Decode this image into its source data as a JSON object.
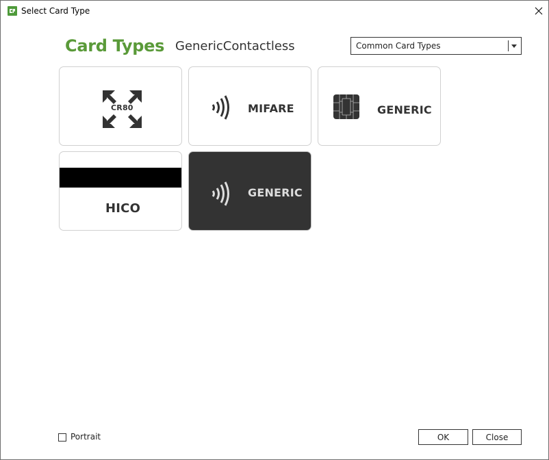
{
  "window": {
    "title": "Select Card Type",
    "app_icon": "cp-logo-icon",
    "close_icon": "close-icon"
  },
  "header": {
    "heading": "Card Types",
    "selected_type": "GenericContactless",
    "category_select": {
      "value": "Common Card Types",
      "icon": "chevron-down-icon"
    }
  },
  "colors": {
    "accent_green": "#5a9a39",
    "selected_card_bg": "#333333",
    "icon_dark": "#333333"
  },
  "cards": [
    {
      "label": "CR80",
      "icon": "cr80-expand-icon",
      "selected": false
    },
    {
      "label": "MIFARE",
      "icon": "contactless-icon",
      "selected": false
    },
    {
      "label": "GENERIC",
      "icon": "smart-chip-icon",
      "selected": false
    },
    {
      "label": "HICO",
      "icon": "magnetic-stripe-icon",
      "selected": false
    },
    {
      "label": "GENERIC",
      "icon": "contactless-icon",
      "selected": true
    }
  ],
  "footer": {
    "portrait_label": "Portrait",
    "portrait_checked": false,
    "ok_label": "OK",
    "close_label": "Close"
  }
}
